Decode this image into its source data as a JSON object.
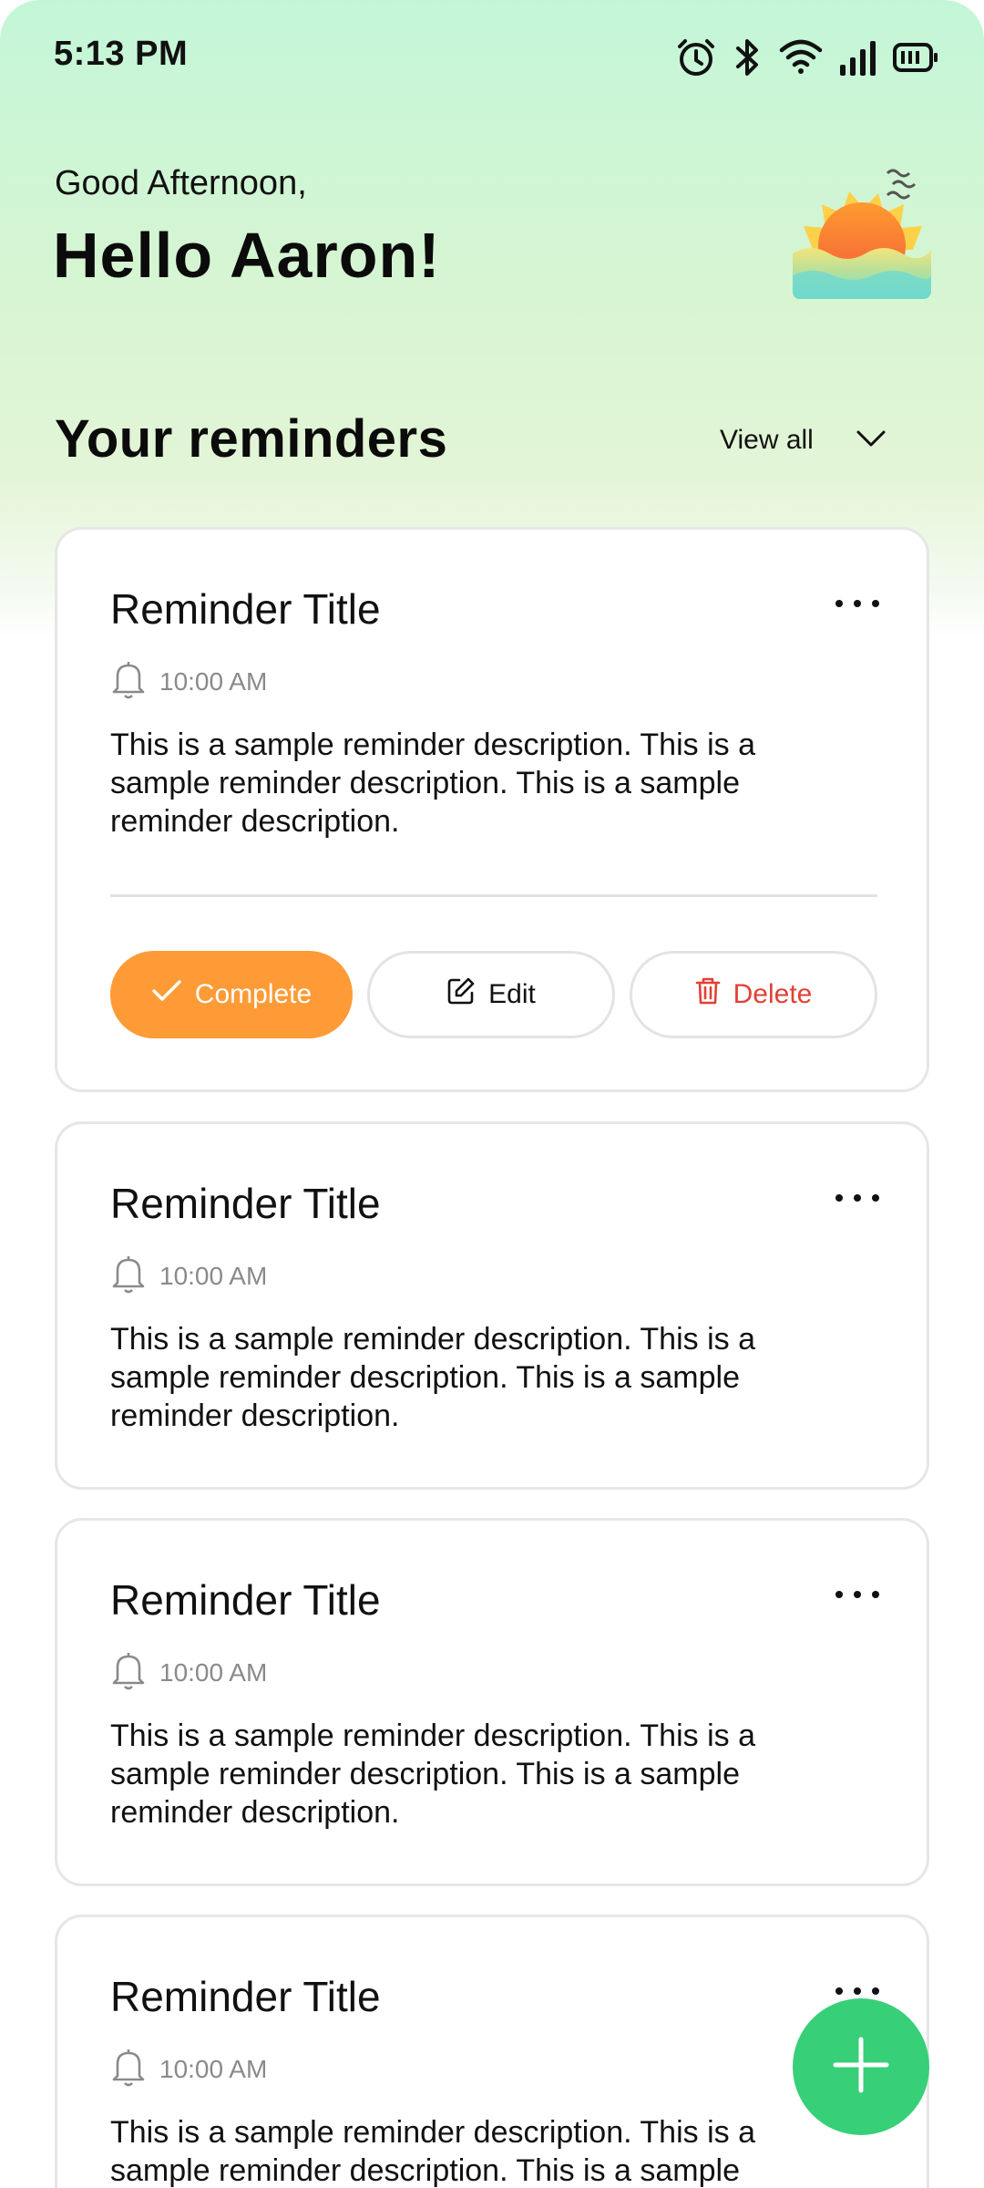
{
  "status_bar": {
    "time": "5:13 PM",
    "icons": [
      "alarm-icon",
      "bluetooth-icon",
      "wifi-icon",
      "signal-icon",
      "battery-icon"
    ]
  },
  "header": {
    "greeting": "Good Afternoon,",
    "hello": "Hello Aaron!",
    "illustration": "sunset-icon"
  },
  "reminders_section": {
    "title": "Your reminders",
    "view_all_label": "View all"
  },
  "reminders": [
    {
      "title": "Reminder Title",
      "time": "10:00 AM",
      "description": "This is a sample reminder description. This is a sample reminder description. This is a sample reminder description.",
      "expanded": true,
      "actions": {
        "complete": "Complete",
        "edit": "Edit",
        "delete": "Delete"
      }
    },
    {
      "title": "Reminder Title",
      "time": "10:00 AM",
      "description": "This is a sample reminder description. This is a sample reminder description. This is a sample reminder description."
    },
    {
      "title": "Reminder Title",
      "time": "10:00 AM",
      "description": "This is a sample reminder description. This is a sample reminder description. This is a sample reminder description."
    },
    {
      "title": "Reminder Title",
      "time": "10:00 AM",
      "description": "This is a sample reminder description. This is a sample reminder description. This is a sample reminder description."
    }
  ],
  "colors": {
    "complete_button": "#fe9b36",
    "delete_text": "#e24034",
    "fab": "#38cf79",
    "header_gradient_top": "#c3f6d8"
  },
  "fab": {
    "icon": "plus-icon"
  }
}
